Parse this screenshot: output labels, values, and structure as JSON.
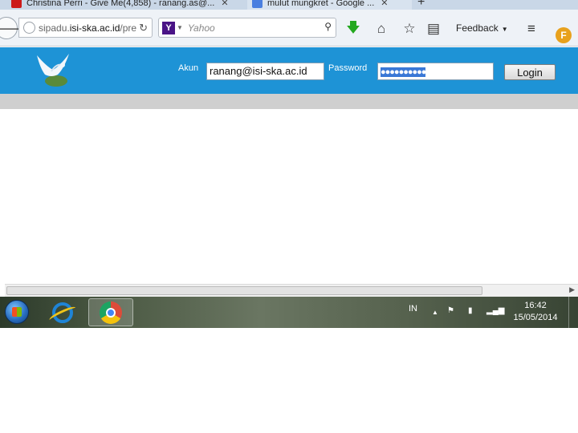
{
  "browser": {
    "tabs": [
      {
        "label": "Christina Perri - Give Me(4,858) - ranang.as@..."
      },
      {
        "label": "mulut mungkret - Google ..."
      }
    ],
    "new_tab_label": "+",
    "url_prefix": "sipadu.",
    "url_domain": "isi-ska.ac.id",
    "url_suffix": "/pre",
    "search_engine_letter": "Y",
    "search_placeholder": "Yahoo",
    "feedback_label": "Feedback",
    "addon_letter": "F",
    "icons": [
      "back-icon",
      "globe-icon",
      "reload-icon",
      "search-icon",
      "download-icon",
      "home-icon",
      "star-icon",
      "reading-list-icon",
      "menu-icon"
    ]
  },
  "site": {
    "akun_label": "Akun",
    "akun_value": "ranang@isi-ska.ac.id",
    "password_label": "Password",
    "password_mask": "●●●●●●●●●●",
    "login_label": "Login",
    "header_color": "#1e93d6"
  },
  "scrollbar": {
    "thumb_fraction": 0.85
  },
  "taskbar": {
    "language": "IN",
    "time": "16:42",
    "date": "15/05/2014",
    "pinned": [
      "internet-explorer-icon",
      "chrome-icon"
    ]
  }
}
